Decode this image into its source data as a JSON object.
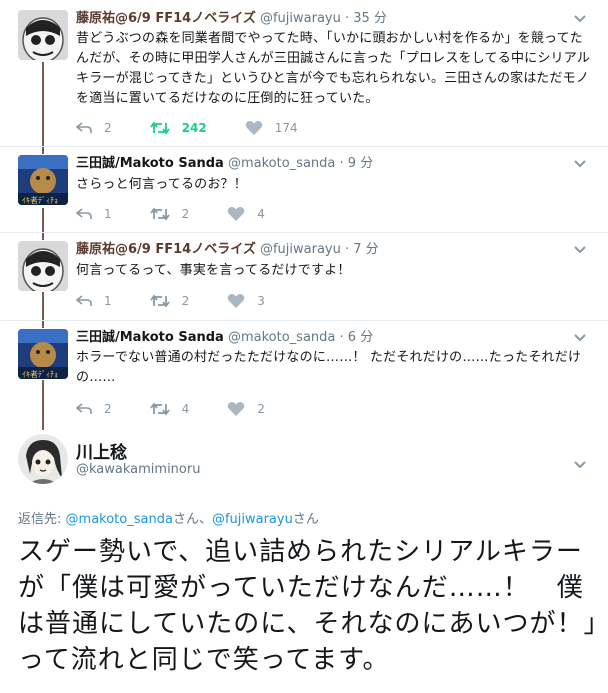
{
  "tweets": [
    {
      "name": "藤原祐@6/9 FF14ノベライズ",
      "handle": "@fujiwarayu",
      "dot": "·",
      "time": "35 分",
      "text": "昔どうぶつの森を同業者間でやってた時、「いかに頭おかしい村を作るか」を競ってたんだが、その時に甲田学人さんが三田誠さんに言った「プロレスをしてる中にシリアルキラーが混じってきた」というひと言が今でも忘れられない。三田さんの家はただモノを適当に置いてるだけなのに圧倒的に狂っていた。",
      "replies": "2",
      "retweets": "242",
      "likes": "174"
    },
    {
      "name": "三田誠/Makoto Sanda",
      "handle": "@makoto_sanda",
      "dot": "·",
      "time": "9 分",
      "text": "さらっと何言ってるのお？！",
      "replies": "1",
      "retweets": "2",
      "likes": "4"
    },
    {
      "name": "藤原祐@6/9 FF14ノベライズ",
      "handle": "@fujiwarayu",
      "dot": "·",
      "time": "7 分",
      "text": "何言ってるって、事実を言ってるだけですよ！",
      "replies": "1",
      "retweets": "2",
      "likes": "3"
    },
    {
      "name": "三田誠/Makoto Sanda",
      "handle": "@makoto_sanda",
      "dot": "·",
      "time": "6 分",
      "text": "ホラーでない普通の村だったただけなのに……！ ただそれだけの……たったそれだけの……",
      "replies": "2",
      "retweets": "4",
      "likes": "2"
    }
  ],
  "main": {
    "name": "川上稔",
    "handle": "@kawakamiminoru",
    "reply_label": "返信先:",
    "reply_user1": "@makoto_sanda",
    "reply_san1": "さん、",
    "reply_user2": "@fujiwarayu",
    "reply_san2": "さん",
    "text": "スゲー勢いで、追い詰められたシリアルキラーが「僕は可愛がっていただけなんだ……！　僕は普通にしていたのに、それなのにあいつが！」って流れと同じで笑ってます。"
  },
  "colors": {
    "retweet_active": "#19cf86",
    "link": "#1b95e0",
    "muted": "#657786",
    "thread_line": "#7a5c55"
  },
  "icons": {
    "reply": "reply-icon",
    "retweet": "retweet-icon",
    "like": "heart-icon",
    "menu": "chevron-down-icon"
  }
}
